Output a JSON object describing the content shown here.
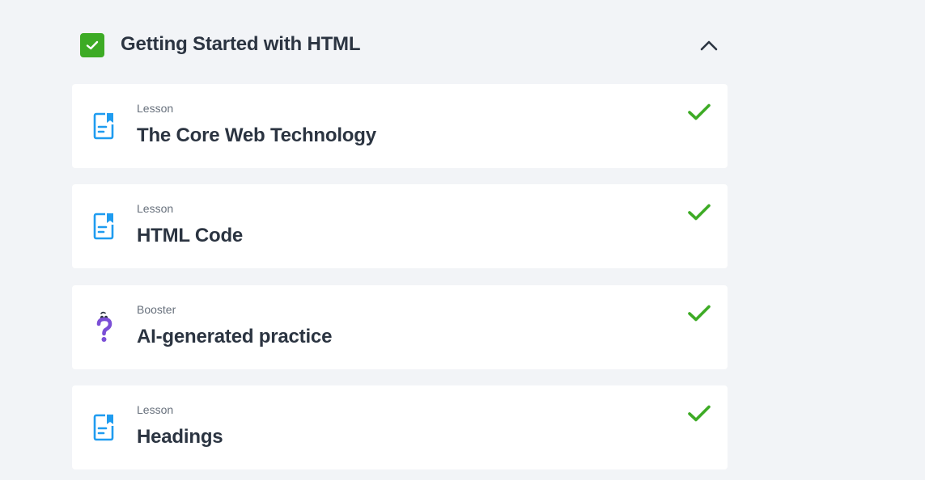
{
  "module": {
    "title": "Getting Started with HTML",
    "completed": true,
    "state_icon": "chevron-up-icon",
    "items": [
      {
        "type": "Lesson",
        "title": "The Core Web Technology",
        "icon": "lesson-document-icon",
        "completed": true
      },
      {
        "type": "Lesson",
        "title": "HTML Code",
        "icon": "lesson-document-icon",
        "completed": true
      },
      {
        "type": "Booster",
        "title": "AI-generated practice",
        "icon": "question-mark-icon",
        "completed": true
      },
      {
        "type": "Lesson",
        "title": "Headings",
        "icon": "lesson-document-icon",
        "completed": true
      }
    ]
  },
  "colors": {
    "completed_green": "#3dab25",
    "lesson_icon_blue": "#1f9cf0",
    "booster_icon_purple": "#7b4fd6",
    "text_dark": "#2b3441",
    "text_muted": "#67707c",
    "page_background": "#f2f4f7"
  }
}
